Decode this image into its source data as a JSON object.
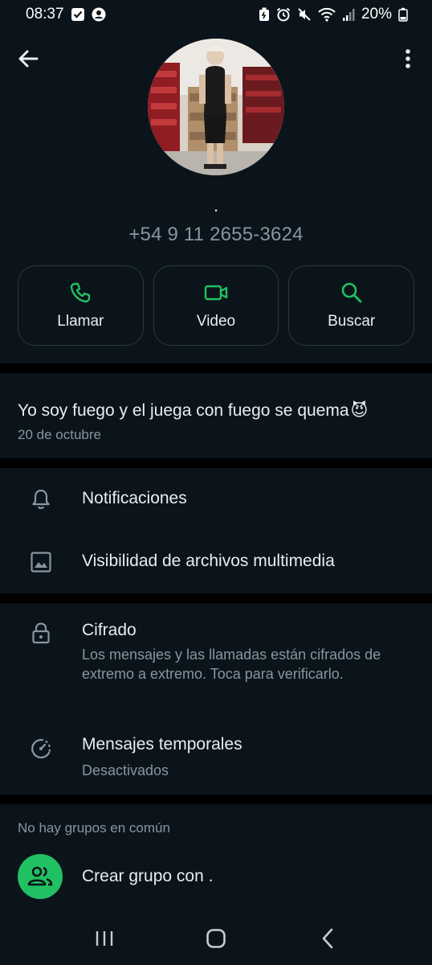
{
  "status_bar": {
    "time": "08:37",
    "battery": "20%",
    "icons": [
      "check-box-icon",
      "account-circle-icon",
      "battery-saver-icon",
      "alarm-icon",
      "mute-icon",
      "wifi-icon",
      "signal-icon",
      "battery-icon"
    ]
  },
  "header": {
    "name": ".",
    "phone": "+54 9 11 2655-3624"
  },
  "actions": [
    {
      "label": "Llamar",
      "icon": "phone-icon"
    },
    {
      "label": "Video",
      "icon": "video-icon"
    },
    {
      "label": "Buscar",
      "icon": "search-icon"
    }
  ],
  "about": {
    "text": "Yo soy fuego y el juega con fuego se quema",
    "emoji": "😈",
    "date": "20 de octubre"
  },
  "settings": {
    "notifications": "Notificaciones",
    "media_visibility": "Visibilidad de archivos multimedia",
    "encryption_title": "Cifrado",
    "encryption_sub": "Los mensajes y las llamadas están cifrados de extremo a extremo. Toca para verificarlo.",
    "disappearing_title": "Mensajes temporales",
    "disappearing_sub": "Desactivados"
  },
  "groups": {
    "label": "No hay grupos en común",
    "create": "Crear grupo con ."
  },
  "colors": {
    "accent": "#21c063",
    "background": "#0b141a",
    "divider": "#000000",
    "secondary_text": "#8696a0"
  }
}
